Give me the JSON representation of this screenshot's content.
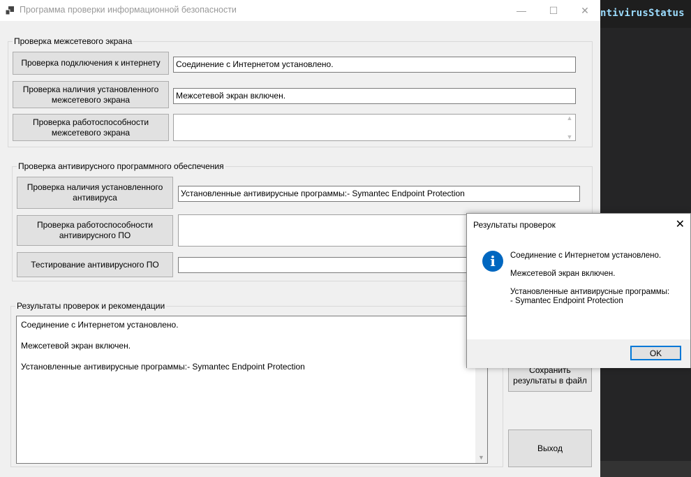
{
  "window": {
    "title": "Программа проверки информационной безопасности",
    "minimize": "—",
    "maximize": "☐",
    "close": "✕"
  },
  "firewall_group": {
    "legend": "Проверка межсетевого экрана",
    "btn_internet": "Проверка подключения к интернету",
    "internet_result": "Соединение с Интернетом установлено.",
    "btn_installed": "Проверка наличия установленного межсетевого экрана",
    "installed_result": "Межсетевой экран включен.",
    "btn_working": "Проверка работоспособности межсетевого экрана",
    "working_result": ""
  },
  "antivirus_group": {
    "legend": "Проверка антивирусного программного обеспечения",
    "btn_installed": "Проверка наличия установленного антивируса",
    "installed_result": "Установленные антивирусные программы:- Symantec Endpoint Protection",
    "btn_working": "Проверка работоспособности антивирусного ПО",
    "working_result": "",
    "btn_test": "Тестирование антивирусного ПО",
    "test_result": ""
  },
  "results_group": {
    "legend": "Результаты проверок и рекомендации",
    "text": "Соединение с Интернетом установлено.\n\nМежсетевой экран включен.\n\nУстановленные антивирусные программы:- Symantec Endpoint Protection",
    "btn_save": "Сохранить результаты в файл",
    "btn_exit": "Выход"
  },
  "dialog": {
    "title": "Результаты проверок",
    "close": "✕",
    "icon": "i",
    "message": "Соединение с Интернетом установлено.\n\nМежсетевой экран включен.\n\nУстановленные антивирусные программы:\n- Symantec Endpoint Protection",
    "ok": "OK"
  },
  "editor": {
    "code": "ntivirusStatus"
  },
  "colors": {
    "accent": "#0078d7",
    "info_icon": "#0067c0",
    "editor_bg": "#1e1e1e"
  }
}
